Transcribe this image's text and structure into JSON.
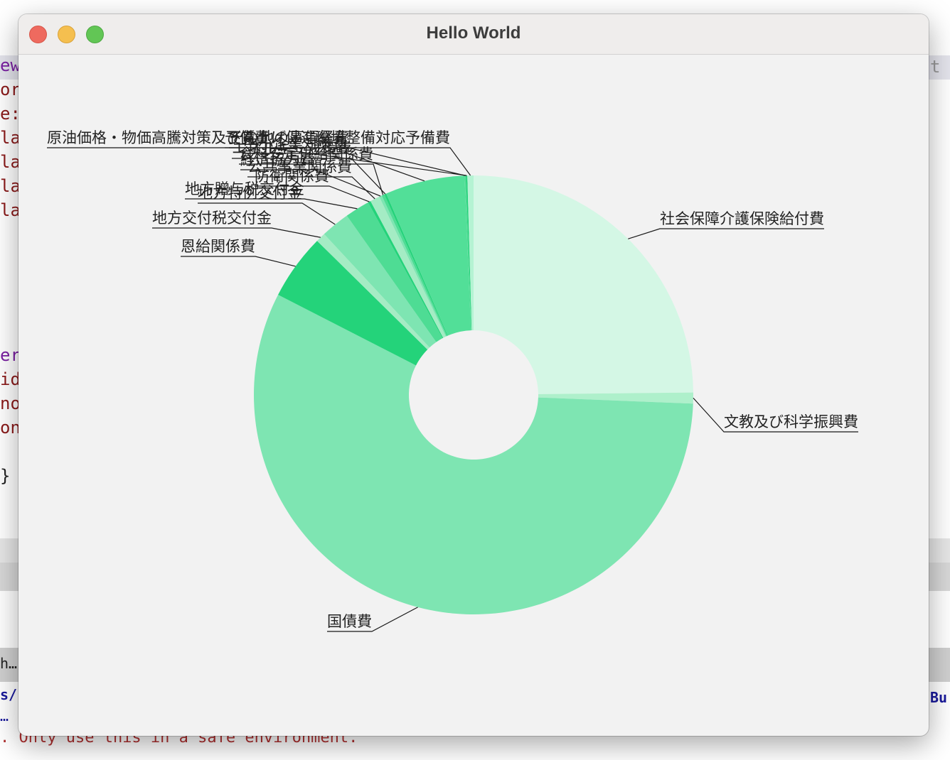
{
  "background": {
    "code_fragments": [
      {
        "text": "ew",
        "color": "#7a1fa2"
      },
      {
        "text": "or",
        "color": "#8b1a1a"
      },
      {
        "text": "e:",
        "color": "#8b1a1a"
      },
      {
        "text": "la",
        "color": "#8b1a1a"
      },
      {
        "text": "la",
        "color": "#8b1a1a"
      },
      {
        "text": "la",
        "color": "#8b1a1a"
      },
      {
        "text": "la",
        "color": "#8b1a1a"
      },
      {
        "text": "er",
        "color": "#7a1fa2"
      },
      {
        "text": "id",
        "color": "#8b1a1a"
      },
      {
        "text": "no",
        "color": "#8b1a1a"
      },
      {
        "text": "on",
        "color": "#8b1a1a"
      },
      {
        "text": "}",
        "color": "#222222"
      },
      {
        "text": "h…",
        "color": "#222222"
      },
      {
        "text": "s/",
        "color": "#1a1a9c"
      },
      {
        "text": "…",
        "color": "#1a1a9c"
      }
    ],
    "right_fragment_1": "t",
    "right_fragment_2": "Bu",
    "bottom_message": ". Only use this in a safe environment."
  },
  "window": {
    "title": "Hello World",
    "buttons": {
      "close": "close",
      "minimize": "minimize",
      "maximize": "maximize"
    }
  },
  "chart_data": {
    "type": "donut",
    "title": "",
    "colors": {
      "base": "#5adc9a"
    },
    "slices": [
      {
        "label": "社会保障介護保険給付費",
        "value": 24.6,
        "color": "#d4f7e5"
      },
      {
        "label": "文教及び科学振興費",
        "value": 0.8,
        "color": "#aef0cb"
      },
      {
        "label": "国債費",
        "value": 56.4,
        "color": "#7ee5b2"
      },
      {
        "label": "恩給関係費",
        "value": 4.8,
        "color": "#24d37a"
      },
      {
        "label": "地方交付税交付金",
        "value": 0.7,
        "color": "#a4ecc4"
      },
      {
        "label": "地方特例交付金",
        "value": 2.1,
        "color": "#7ee5b2"
      },
      {
        "label": "地方贈与税交付金",
        "value": 1.8,
        "color": "#4edc94"
      },
      {
        "label": "防衛関係費",
        "value": 0.2,
        "color": "#24d37a"
      },
      {
        "label": "公共事業関係費",
        "value": 0.7,
        "color": "#a4ecc4"
      },
      {
        "label": "経済協力費",
        "value": 0.2,
        "color": "#7ee5b2"
      },
      {
        "label": "食料安定供給関係費",
        "value": 0.2,
        "color": "#4edc94"
      },
      {
        "label": "エネルギー対策費",
        "value": 0.15,
        "color": "#24d37a"
      },
      {
        "label": "中小企業対策費",
        "value": 5.8,
        "color": "#52df98"
      },
      {
        "label": "その他の事項経費",
        "value": 0.1,
        "color": "#4edc94"
      },
      {
        "label": "予備費",
        "value": 0.1,
        "color": "#24d37a"
      },
      {
        "label": "原油価格・物価高騰対策及び賃上げ促進環境整備対応予備費",
        "value": 0.45,
        "color": "#b5f3d3"
      }
    ]
  }
}
